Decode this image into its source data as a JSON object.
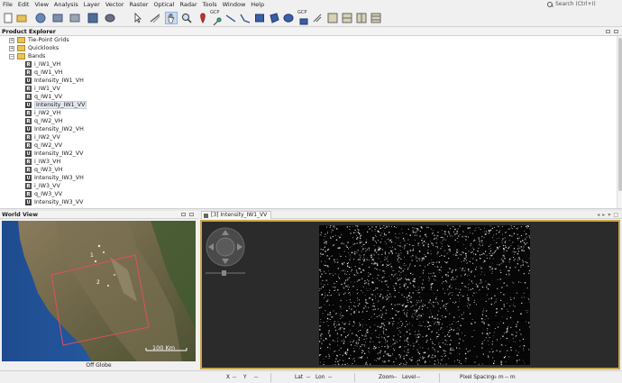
{
  "menu": [
    "File",
    "Edit",
    "View",
    "Analysis",
    "Layer",
    "Vector",
    "Raster",
    "Optical",
    "Radar",
    "Tools",
    "Window",
    "Help"
  ],
  "search": {
    "placeholder": "Search (Ctrl+I)"
  },
  "toolbar": {
    "gcp_label": "GCP",
    "gcp_label2": "GCP"
  },
  "product_explorer": {
    "title": "Product Explorer",
    "folders": [
      "Tie-Point Grids",
      "Quicklooks",
      "Bands"
    ],
    "bands": [
      {
        "icon": "R",
        "label": "i_IW1_VH"
      },
      {
        "icon": "R",
        "label": "q_IW1_VH"
      },
      {
        "icon": "U",
        "label": "Intensity_IW1_VH"
      },
      {
        "icon": "R",
        "label": "i_IW1_VV"
      },
      {
        "icon": "R",
        "label": "q_IW1_VV"
      },
      {
        "icon": "U",
        "label": "Intensity_IW1_VV"
      },
      {
        "icon": "R",
        "label": "i_IW2_VH"
      },
      {
        "icon": "R",
        "label": "q_IW2_VH"
      },
      {
        "icon": "U",
        "label": "Intensity_IW2_VH"
      },
      {
        "icon": "R",
        "label": "i_IW2_VV"
      },
      {
        "icon": "R",
        "label": "q_IW2_VV"
      },
      {
        "icon": "U",
        "label": "Intensity_IW2_VV"
      },
      {
        "icon": "R",
        "label": "i_IW3_VH"
      },
      {
        "icon": "R",
        "label": "q_IW3_VH"
      },
      {
        "icon": "U",
        "label": "Intensity_IW3_VH"
      },
      {
        "icon": "R",
        "label": "i_IW3_VV"
      },
      {
        "icon": "R",
        "label": "q_IW3_VV"
      },
      {
        "icon": "U",
        "label": "Intensity_IW3_VV"
      }
    ],
    "selected_band": "Intensity_IW1_VV"
  },
  "world_view": {
    "title": "World View",
    "scale_label": "100 Km",
    "footer": "Off Globe",
    "footprint_numbers": [
      "1",
      "2"
    ],
    "footprint_color": "#e0505a"
  },
  "image_view": {
    "tab_label": "[3] Intensity_IW1_VV",
    "frame_color": "#c6a74a",
    "nav_left": "◂",
    "nav_right": "▸",
    "nav_more": "▾",
    "nav_restore": "□"
  },
  "status": {
    "x_label": "X",
    "x_value": "--",
    "y_label": "Y",
    "y_value": "--",
    "lat_label": "Lat",
    "lat_value": "--",
    "lon_label": "Lon",
    "lon_value": "--",
    "zoom_label": "Zoom",
    "zoom_value": "--",
    "level_label": "Level",
    "level_value": "--",
    "spacing_label": "Pixel Spacing:",
    "spacing_value": "-- m",
    "spacing_value2": "-- m"
  }
}
